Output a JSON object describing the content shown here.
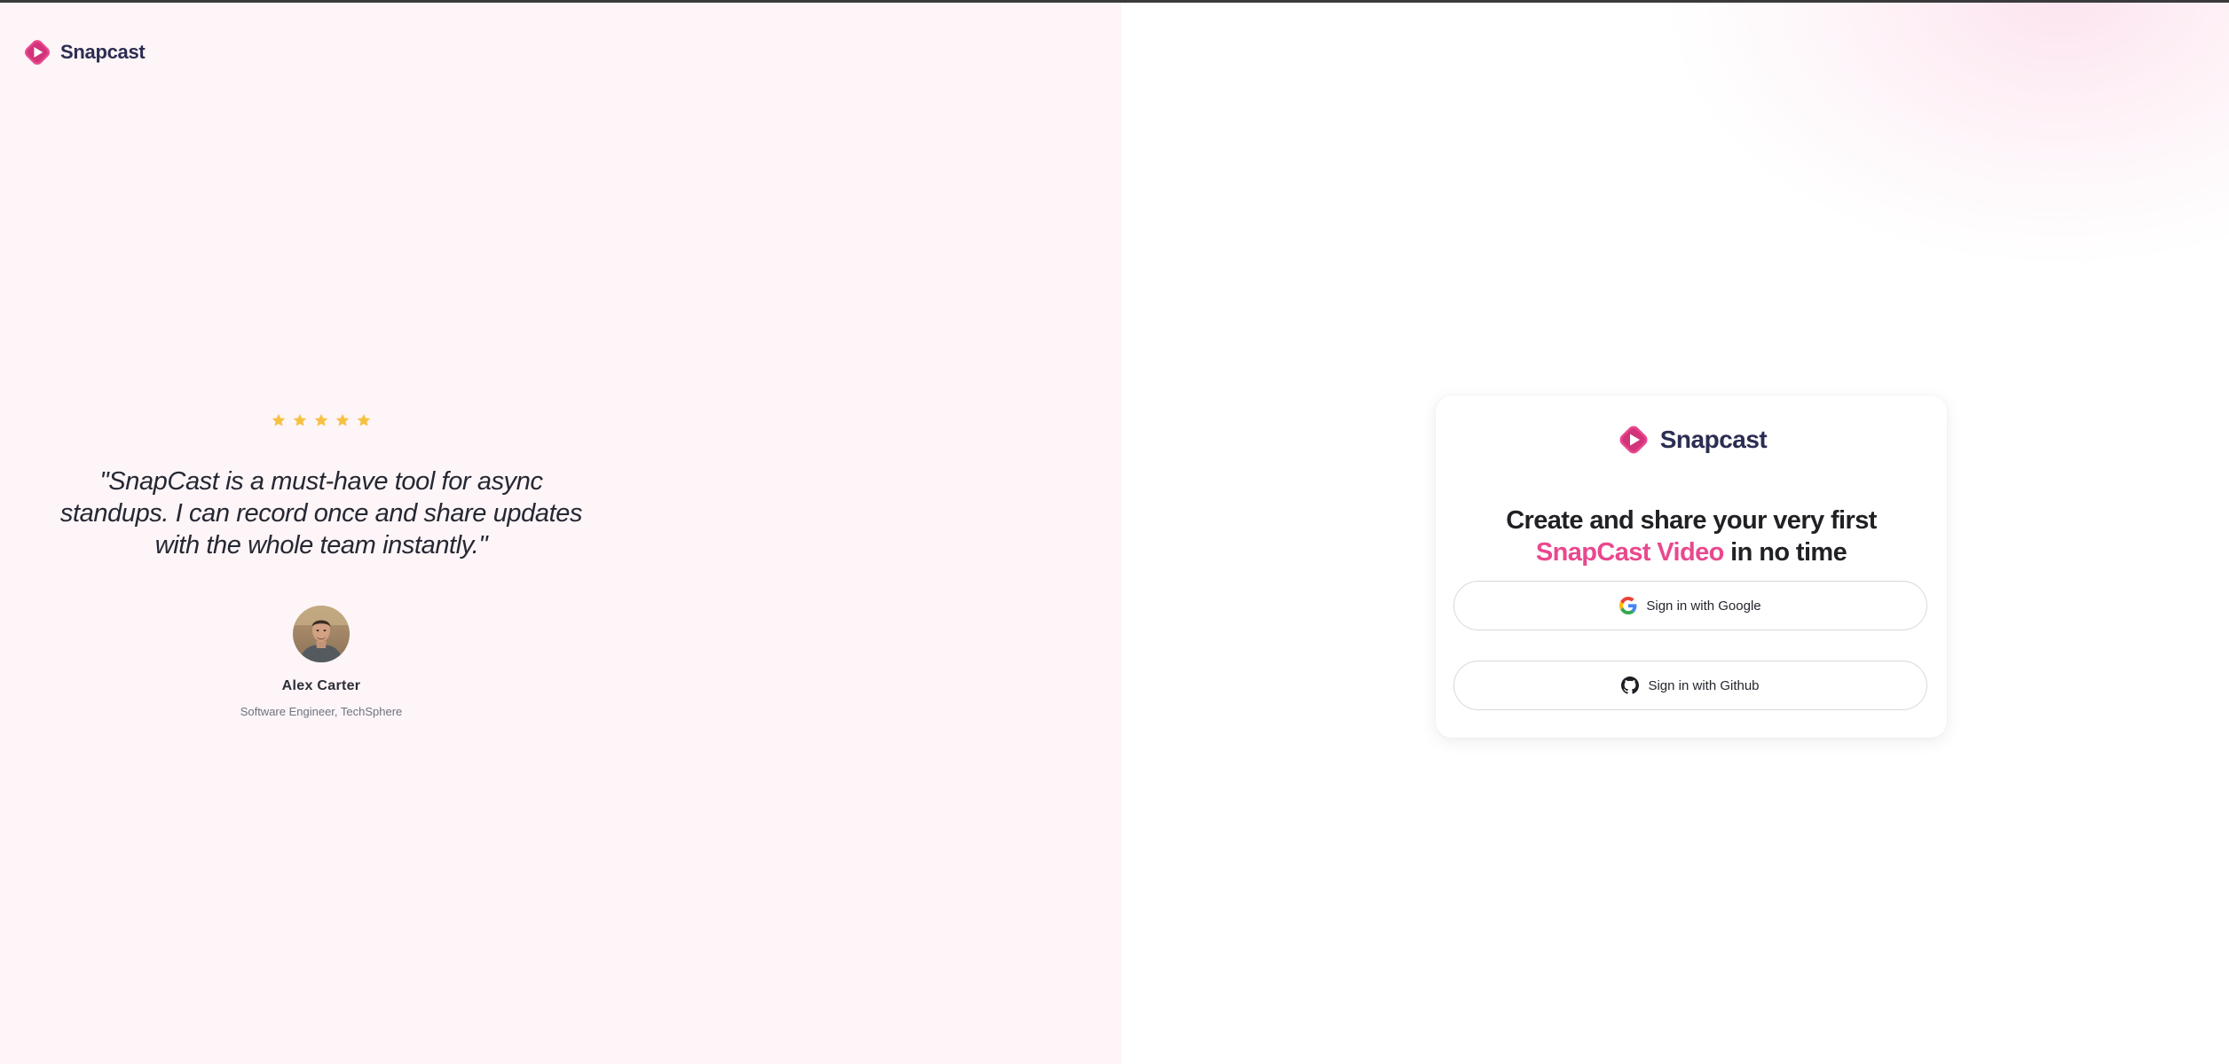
{
  "brand": {
    "name": "Snapcast",
    "accent_color": "#e9488e",
    "text_color": "#2b2d52"
  },
  "testimonial": {
    "rating": 5,
    "max_rating": 5,
    "quote": "\"SnapCast is a must-have tool for async standups. I can record once and share updates with the whole team instantly.\"",
    "author_name": "Alex Carter",
    "author_title": "Software Engineer, TechSphere"
  },
  "card": {
    "brand_name": "Snapcast",
    "headline_prefix": "Create and share your very first ",
    "headline_accent": "SnapCast Video",
    "headline_suffix": " in no time",
    "google_button": {
      "label": "Sign in with Google",
      "icon": "google-icon"
    },
    "github_button": {
      "label": "Sign in with Github",
      "icon": "github-icon"
    }
  }
}
